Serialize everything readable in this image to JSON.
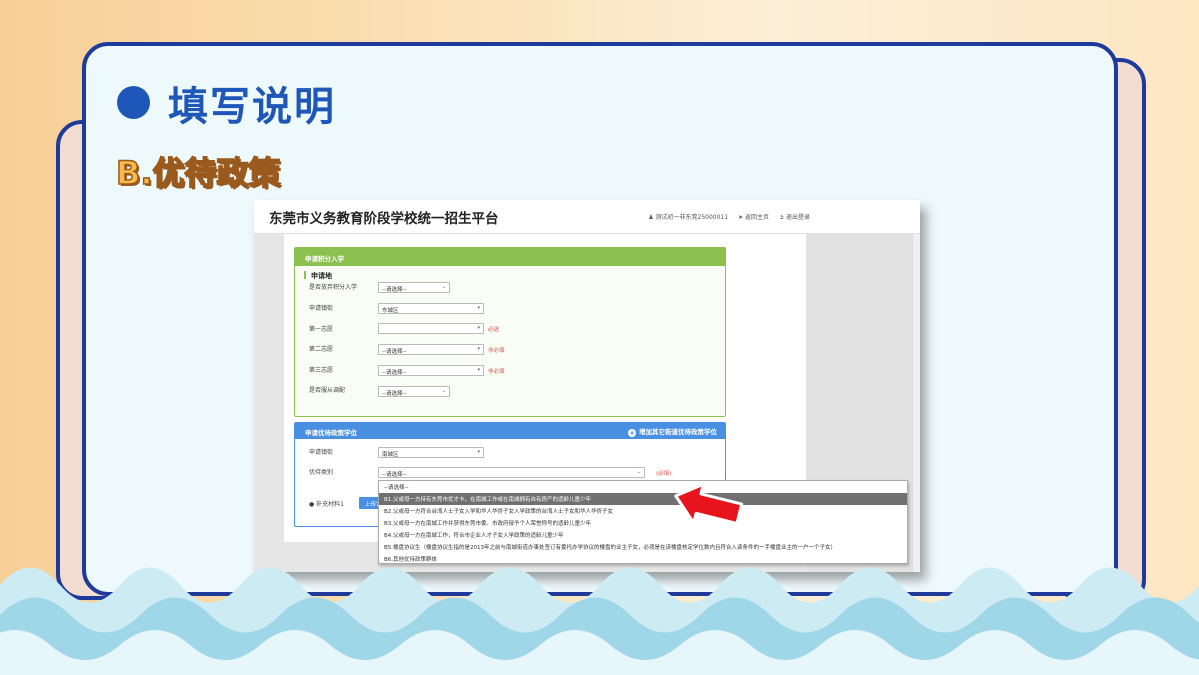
{
  "slide": {
    "title": "填写说明",
    "subtitle": "B.优待政策"
  },
  "site": {
    "title": "东莞市义务教育阶段学校统一招生平台",
    "user_link": "测试初一非东莞25000011",
    "home_link": "返回主页",
    "logout_link": "退出登录"
  },
  "points_panel": {
    "title": "申请积分入学",
    "section_label": "申请地",
    "fields": [
      {
        "label": "是否放弃积分入学",
        "value": "--请选择--",
        "note": ""
      },
      {
        "label": "申请镇街",
        "value": "东城区",
        "note": ""
      },
      {
        "label": "第一志愿",
        "value": "",
        "note": "必选"
      },
      {
        "label": "第二志愿",
        "value": "--请选择--",
        "note": "非必填"
      },
      {
        "label": "第三志愿",
        "value": "--请选择--",
        "note": "非必填"
      },
      {
        "label": "是否服从调配",
        "value": "--请选择--",
        "note": ""
      }
    ]
  },
  "policy_panel": {
    "title": "申请优待政策学位",
    "add_link": "增加其它街道优待政策学位",
    "town_label": "申请镇街",
    "town_value": "南城区",
    "category_label": "优待类别",
    "category_value": "--请选择--",
    "category_note": "(必填)",
    "supplement_label": "补充材料1",
    "upload_label": "上传证件"
  },
  "dropdown": {
    "options": [
      "--请选择--",
      "B1.父或母一方持有东莞市优才卡，在南城工作或在南城拥有自有房产的适龄儿童少年",
      "B2.父或母一方符合台湾人士子女入学和华人华侨子女入学政策的台湾人士子女和华人华侨子女",
      "B3.父或母一方在南城工作并获得东莞市委、市政府授予个人荣誉称号的适龄儿童少年",
      "B4.父或母一方在南城工作，符合市企业人才子女入学政策的适龄儿童少年",
      "B5.楼盘协议生（楼盘协议生指的是2013年之前与南城街道办事处签订有委托办学协议的楼盘的业主子女，必须是在该楼盘核定学位数内且符合入读条件的一手楼盘业主的一户一个子女）",
      "B6.其他优待政策群体"
    ],
    "highlighted_index": 1
  },
  "colors": {
    "frame_border": "#1e3a9a",
    "title_blue": "#1e57b8",
    "subtitle_orange": "#f8b84a",
    "green_panel": "#8cc152",
    "blue_panel": "#4a90e2",
    "arrow_red": "#e8141c",
    "wave_light": "#cdebf3",
    "wave_mid": "#9fd6e8"
  }
}
